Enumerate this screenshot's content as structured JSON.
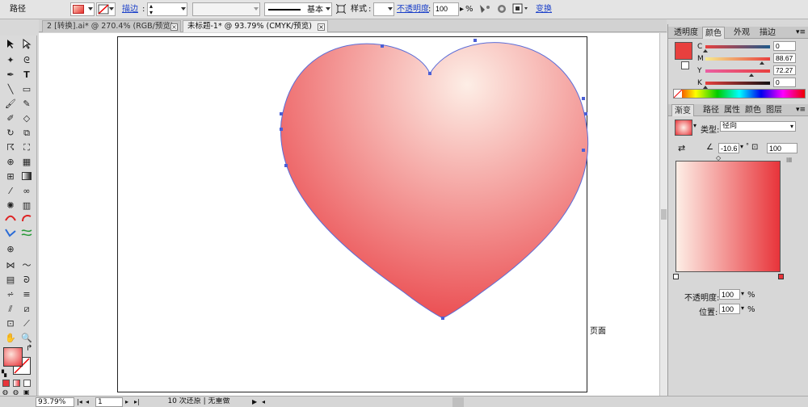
{
  "control_bar": {
    "path_label": "路径",
    "stroke_label": "描边",
    "stroke_profile": "基本",
    "style_label": "样式",
    "opacity_label": "不透明度",
    "opacity_value": "100",
    "opacity_unit": "%",
    "transform_label": "变换"
  },
  "tabs": [
    {
      "label": "2 [转换].ai* @ 270.4% (RGB/预览)",
      "active": false
    },
    {
      "label": "未标题-1* @ 93.79% (CMYK/预览)",
      "active": true
    }
  ],
  "tools": {
    "icons": [
      "selection-tool",
      "direct-selection-tool",
      "magic-wand-tool",
      "lasso-tool",
      "pen-tool",
      "type-tool",
      "line-tool",
      "rectangle-tool",
      "paintbrush-tool",
      "pencil-tool",
      "blob-brush-tool",
      "eraser-tool",
      "rotate-tool",
      "scale-tool",
      "warp-tool",
      "free-transform-tool",
      "shape-builder-tool",
      "perspective-grid-tool",
      "mesh-tool",
      "gradient-tool",
      "eyedropper-tool",
      "blend-tool",
      "symbol-sprayer-tool",
      "column-graph-tool",
      "artboard-tool",
      "slice-tool",
      "hand-tool",
      "zoom-tool"
    ]
  },
  "canvas": {
    "page_label": "页面"
  },
  "status_bar": {
    "zoom_value": "93.79%",
    "artboard_number": "1",
    "history_text": "10 次还原 | 无重做"
  },
  "colors": {
    "heart_gradient_start": "#fdeee6",
    "heart_gradient_end": "#e8343a",
    "path_outline": "#5b6dd8"
  },
  "color_panel": {
    "tabs": [
      "透明度",
      "颜色",
      "外观",
      "描边"
    ],
    "active_tab": "颜色",
    "channels": [
      {
        "label": "C",
        "value": "0"
      },
      {
        "label": "M",
        "value": "88.67"
      },
      {
        "label": "Y",
        "value": "72.27"
      },
      {
        "label": "K",
        "value": "0"
      }
    ]
  },
  "gradient_panel": {
    "tabs": [
      "渐变",
      "路径",
      "属性",
      "颜色",
      "图层"
    ],
    "active_tab": "渐变",
    "type_label": "类型:",
    "type_value": "径向",
    "angle_value": "-10.6",
    "aspect_value": "100",
    "opacity_label": "不透明度:",
    "opacity_value": "100",
    "position_label": "位置:",
    "position_value": "100",
    "percent": "%"
  }
}
